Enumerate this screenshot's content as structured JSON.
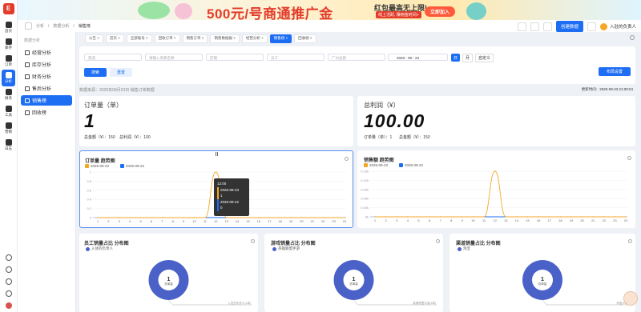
{
  "banner": {
    "headline": "500元/号商通推广金",
    "sub": "红包最高无上限!",
    "sub2": "线上活跃, 赚佣金时间>",
    "cta": "立即加入"
  },
  "sidebar": {
    "logo": "E",
    "items": [
      {
        "label": "首页"
      },
      {
        "label": "库存"
      },
      {
        "label": "订单"
      },
      {
        "label": "分析",
        "active": true
      },
      {
        "label": "财务"
      },
      {
        "label": "工具"
      },
      {
        "label": "营销"
      },
      {
        "label": "日志"
      }
    ]
  },
  "submenu": {
    "title": "数据分析",
    "items": [
      {
        "label": "经营分析"
      },
      {
        "label": "库存分析"
      },
      {
        "label": "财务分析"
      },
      {
        "label": "售后分析"
      },
      {
        "label": "销售榜",
        "active": true
      },
      {
        "label": "回收榜"
      }
    ]
  },
  "topbar": {
    "breadcrumbs": [
      "分析",
      "数据分析",
      "销售榜"
    ],
    "create_label": "创建数据",
    "user": "入驻的负责人"
  },
  "tabs": [
    {
      "label": "公告"
    },
    {
      "label": "首页"
    },
    {
      "label": "全部账号"
    },
    {
      "label": "回收订单"
    },
    {
      "label": "销售订单"
    },
    {
      "label": "销售数据报"
    },
    {
      "label": "经营分析"
    },
    {
      "label": "销售榜",
      "active": true
    },
    {
      "label": "回收榜"
    }
  ],
  "filters": {
    "f1": "渠道",
    "f2": "请输入商家名称",
    "f3": "店铺",
    "f4": "员工",
    "f5": "广州总部",
    "date": "2025 - 09 - 23",
    "seg": [
      "日",
      "月",
      "自定义"
    ]
  },
  "buttons": {
    "search": "搜索",
    "reset": "重置",
    "layout": "布局设置"
  },
  "source": {
    "left": "数据来源：2025年09月23日 销售订单数据",
    "right": "更新时间：2025-09-23 21:08:04"
  },
  "stats": {
    "orders": {
      "label": "订单量（单）",
      "value": "1",
      "sub1": "总金额（¥）：150",
      "sub2": "总利润（¥）：100"
    },
    "profit": {
      "label": "总利润（¥）",
      "value": "100.00",
      "sub1": "订单量（单）：1",
      "sub2": "总金额（¥）：150"
    }
  },
  "chart_data": [
    {
      "type": "line",
      "title": "订单量 趋势图",
      "x": [
        "1",
        "2",
        "3",
        "4",
        "5",
        "6",
        "7",
        "8",
        "9",
        "10",
        "11",
        "12",
        "13",
        "14",
        "15",
        "16",
        "17",
        "18",
        "19",
        "20",
        "21",
        "22",
        "23",
        "24"
      ],
      "ylim": [
        0,
        1
      ],
      "yticks": [
        "0",
        "0.2",
        "0.4",
        "0.6",
        "0.8",
        "1"
      ],
      "series": [
        {
          "name": "2025-09-23",
          "color": "#f5a623",
          "values": [
            0,
            0,
            0,
            0,
            0,
            0,
            0,
            0,
            0,
            0,
            0,
            1,
            0,
            0,
            0,
            0,
            0,
            0,
            0,
            0,
            0,
            0,
            0,
            0
          ]
        },
        {
          "name": "2025-09-22",
          "color": "#1e6ef4",
          "values": [
            0,
            0,
            0,
            0,
            0,
            0,
            0,
            0,
            0,
            0,
            0,
            0,
            0,
            0,
            0,
            0,
            0,
            0,
            0,
            0,
            0,
            0,
            0,
            0
          ]
        }
      ],
      "tooltip": {
        "title": "12:00",
        "rows": [
          "2025-09-23",
          "1",
          "2025-09-22",
          "0"
        ]
      }
    },
    {
      "type": "line",
      "title": "销售额 趋势图",
      "x": [
        "1",
        "2",
        "3",
        "4",
        "5",
        "6",
        "7",
        "8",
        "9",
        "10",
        "11",
        "12",
        "13",
        "14",
        "15",
        "16",
        "17",
        "18",
        "19",
        "20",
        "21",
        "22",
        "23",
        "24"
      ],
      "ylim": [
        0,
        150
      ],
      "yticks": [
        "0k",
        "0.03k",
        "0.06k",
        "0.09k",
        "0.12k",
        "0.15k"
      ],
      "series": [
        {
          "name": "2025-09-23",
          "color": "#f5a623",
          "values": [
            0,
            0,
            0,
            0,
            0,
            0,
            0,
            0,
            0,
            0,
            0,
            150,
            0,
            0,
            0,
            0,
            0,
            0,
            0,
            0,
            0,
            0,
            0,
            0
          ]
        },
        {
          "name": "2025-09-22",
          "color": "#1e6ef4",
          "values": [
            0,
            0,
            0,
            0,
            0,
            0,
            0,
            0,
            0,
            0,
            0,
            0,
            0,
            0,
            0,
            0,
            0,
            0,
            0,
            0,
            0,
            0,
            0,
            0
          ]
        }
      ]
    },
    {
      "type": "pie",
      "title": "员工销量占比 分布图",
      "legend": "入驻的负责人",
      "center_value": "1",
      "center_label": "总单量",
      "slices": [
        {
          "name": "入驻的负责人",
          "value": 1
        }
      ],
      "callout": "入驻的负责人(1单)"
    },
    {
      "type": "pie",
      "title": "游戏销量占比 分布图",
      "legend": "英雄联盟手游",
      "center_value": "1",
      "center_label": "总单量",
      "slices": [
        {
          "name": "英雄联盟手游",
          "value": 1
        }
      ],
      "callout": "英雄联盟手游(1单)"
    },
    {
      "type": "pie",
      "title": "渠道销量占比 分布图",
      "legend": "淘宝",
      "center_value": "1",
      "center_label": "总单量",
      "slices": [
        {
          "name": "淘宝",
          "value": 1
        }
      ],
      "callout": "淘宝(1单)"
    }
  ]
}
